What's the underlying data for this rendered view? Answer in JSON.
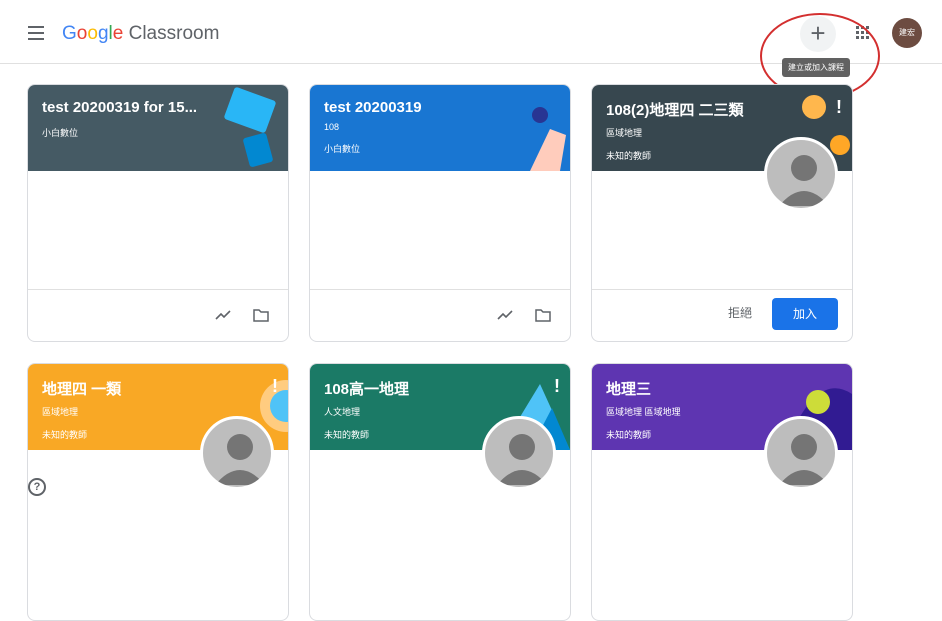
{
  "app": {
    "logo_google": [
      "G",
      "o",
      "o",
      "g",
      "l",
      "e"
    ],
    "logo_classroom": "Classroom",
    "plus_symbol": "+",
    "avatar_text": "建宏",
    "tooltip": "建立或加入課程",
    "help_symbol": "?"
  },
  "colors": {
    "blue": "#1a73e8",
    "slate": "#455a64",
    "orange": "#f9a825",
    "teal": "#1b7a66",
    "purple": "#5e35b1",
    "highlight": "#d32f2f"
  },
  "cards": [
    {
      "title": "test 20200319 for 15...",
      "section": "",
      "owner": "小白數位",
      "footer": "icons"
    },
    {
      "title": "test 20200319",
      "section": "108",
      "owner": "小白數位",
      "footer": "icons"
    },
    {
      "title": "108(2)地理四 二三類",
      "section": "區域地理",
      "owner": "未知的教師",
      "footer": "invite",
      "decline": "拒絕",
      "join": "加入"
    },
    {
      "title": "地理四 一類",
      "section": "區域地理",
      "owner": "未知的教師",
      "footer": "none"
    },
    {
      "title": "108高一地理",
      "section": "人文地理",
      "owner": "未知的教師",
      "footer": "none"
    },
    {
      "title": "地理三",
      "section": "區域地理 區域地理",
      "owner": "未知的教師",
      "footer": "none"
    }
  ]
}
